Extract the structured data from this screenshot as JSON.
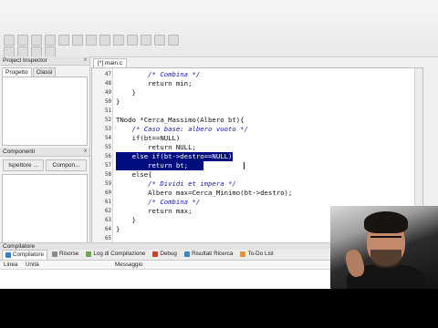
{
  "left_panel": {
    "project_inspector": {
      "title": "Project Inspector",
      "close": "x",
      "tabs": [
        "Progetto",
        "Classi"
      ],
      "active_tab": 0
    },
    "components": {
      "title": "Componenti",
      "close": "x",
      "buttons": [
        "Ispettore ...",
        "Compon..."
      ]
    }
  },
  "editor": {
    "file_tab": "[*] main.c",
    "highlight_color": "#000e80",
    "lines": [
      {
        "n": "47",
        "text": "        /* Combina */",
        "comment": true
      },
      {
        "n": "48",
        "text": "        return min;",
        "comment": false
      },
      {
        "n": "49",
        "text": "    }",
        "comment": false
      },
      {
        "n": "50",
        "text": "}",
        "comment": false
      },
      {
        "n": "51",
        "text": "",
        "comment": false
      },
      {
        "n": "52",
        "text": "TNodo *Cerca_Massimo(Albero bt){",
        "comment": false
      },
      {
        "n": "53",
        "text": "    /* Caso base: albero vuoto */",
        "comment": true
      },
      {
        "n": "54",
        "text": "    if(bt==NULL)",
        "comment": false
      },
      {
        "n": "55",
        "text": "        return NULL;",
        "comment": false
      },
      {
        "n": "56",
        "text": "    else if(bt->destro==NULL)",
        "comment": false,
        "highlight": "partial"
      },
      {
        "n": "57",
        "text": "        return bt;",
        "comment": false,
        "highlight": "full"
      },
      {
        "n": "58",
        "text": "    else{",
        "comment": false
      },
      {
        "n": "59",
        "text": "        /* Dividi et impera */",
        "comment": true
      },
      {
        "n": "60",
        "text": "        Albero max=Cerca_Minimo(bt->destro);",
        "comment": false
      },
      {
        "n": "61",
        "text": "        /* Combina */",
        "comment": true
      },
      {
        "n": "62",
        "text": "        return max;",
        "comment": false
      },
      {
        "n": "63",
        "text": "    }",
        "comment": false
      },
      {
        "n": "64",
        "text": "}",
        "comment": false
      },
      {
        "n": "65",
        "text": "",
        "comment": false
      }
    ]
  },
  "compiler": {
    "title": "Compilatore",
    "tabs": [
      {
        "label": "Compilatore",
        "icon": "compiler-icon",
        "color": "#3a7bd5",
        "active": true
      },
      {
        "label": "Risorse",
        "icon": "resources-icon",
        "color": "#8a8a8a",
        "active": false
      },
      {
        "label": "Log di Compilazione",
        "icon": "log-icon",
        "color": "#6aa84f",
        "active": false
      },
      {
        "label": "Debug",
        "icon": "debug-icon",
        "color": "#cc4125",
        "active": false
      },
      {
        "label": "Risultati Ricerca",
        "icon": "search-results-icon",
        "color": "#3d85c6",
        "active": false
      },
      {
        "label": "To-Do List",
        "icon": "todo-icon",
        "color": "#e69138",
        "active": false
      }
    ],
    "columns": {
      "line": "Linea",
      "unit": "Unità",
      "message": "Messaggio"
    }
  }
}
